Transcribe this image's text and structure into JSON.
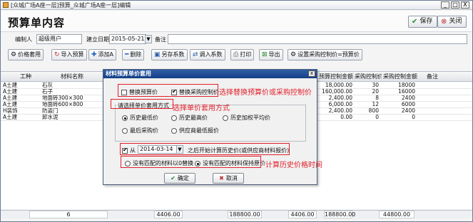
{
  "window": {
    "title": "[众城广场A座一层]预算_众城广场A座一层]编辑",
    "buttons": [
      "_",
      "□",
      "X"
    ]
  },
  "header": {
    "page_title": "预算单内容",
    "save_label": "保存",
    "close_label": "关闭"
  },
  "form": {
    "editor_label": "编制人",
    "editor_value": "超级用户",
    "date_label": "建立日期",
    "date_value": "2015-05-21",
    "note_label": "备注"
  },
  "toolbar": {
    "price_apply": "价格套用",
    "import_budget": "导入预算",
    "add": "添加A",
    "delete": "删除",
    "save_as_coeff": "另存系数",
    "load_coeff": "调入系数",
    "print": "打印",
    "export": "导出",
    "set_control": "设置采购控制价=预算价"
  },
  "grid": {
    "headers": [
      "工种",
      "材料名称",
      "预算控制金额",
      "采购控制价",
      "采购控制金额",
      "备注"
    ],
    "rows": [
      {
        "type": "A土建",
        "name": "石灰",
        "budget_amount": "18,000.00",
        "ctrl_price": "30",
        "ctrl_amount": "18000"
      },
      {
        "type": "A土建",
        "name": "石子",
        "budget_amount": "160,000.00",
        "ctrl_price": "20",
        "ctrl_amount": "16000"
      },
      {
        "type": "A土建",
        "name": "地面砖300×300",
        "budget_amount": "2,400.00",
        "ctrl_price": "8",
        "ctrl_amount": "2400"
      },
      {
        "type": "A土建",
        "name": "地面砖600×800",
        "budget_amount": "6,000.00",
        "ctrl_price": "12",
        "ctrl_amount": "6000"
      },
      {
        "type": "H装饰",
        "name": "防盗门",
        "budget_amount": "2,400.00",
        "ctrl_price": "800",
        "ctrl_amount": "2400"
      },
      {
        "type": "A土建",
        "name": "卸水泥",
        "budget_amount": "0.00",
        "ctrl_price": "0",
        "ctrl_amount": "0"
      }
    ],
    "footer": [
      "6",
      "4406.00",
      "188800.00",
      "4406.00",
      "188800.00",
      "44800.00"
    ]
  },
  "dialog": {
    "title": "材料预算单价套用",
    "close": "x",
    "replace_budget": "替换预算价",
    "replace_purchase": "替换采购控制价",
    "group_label": "请选择单价套用方式",
    "options": [
      "历史最低价",
      "历史最高价",
      "历史加权平均价",
      "最后采购价",
      "供应商最低报价"
    ],
    "from_label": "从",
    "from_date": "2014-03-14",
    "from_suffix": "之后开始计算历史价(或供应商材料报价)",
    "no_match_zero": "没有匹配的材料以0替换",
    "no_match_keep": "没有匹配的材料保持原价",
    "ok": "确定",
    "cancel": "取消"
  },
  "annotations": {
    "replace_note": "选择替换预算价或采购控制价",
    "method_note": "选择单价套用方式",
    "time_note": "计算历史价格时间"
  }
}
